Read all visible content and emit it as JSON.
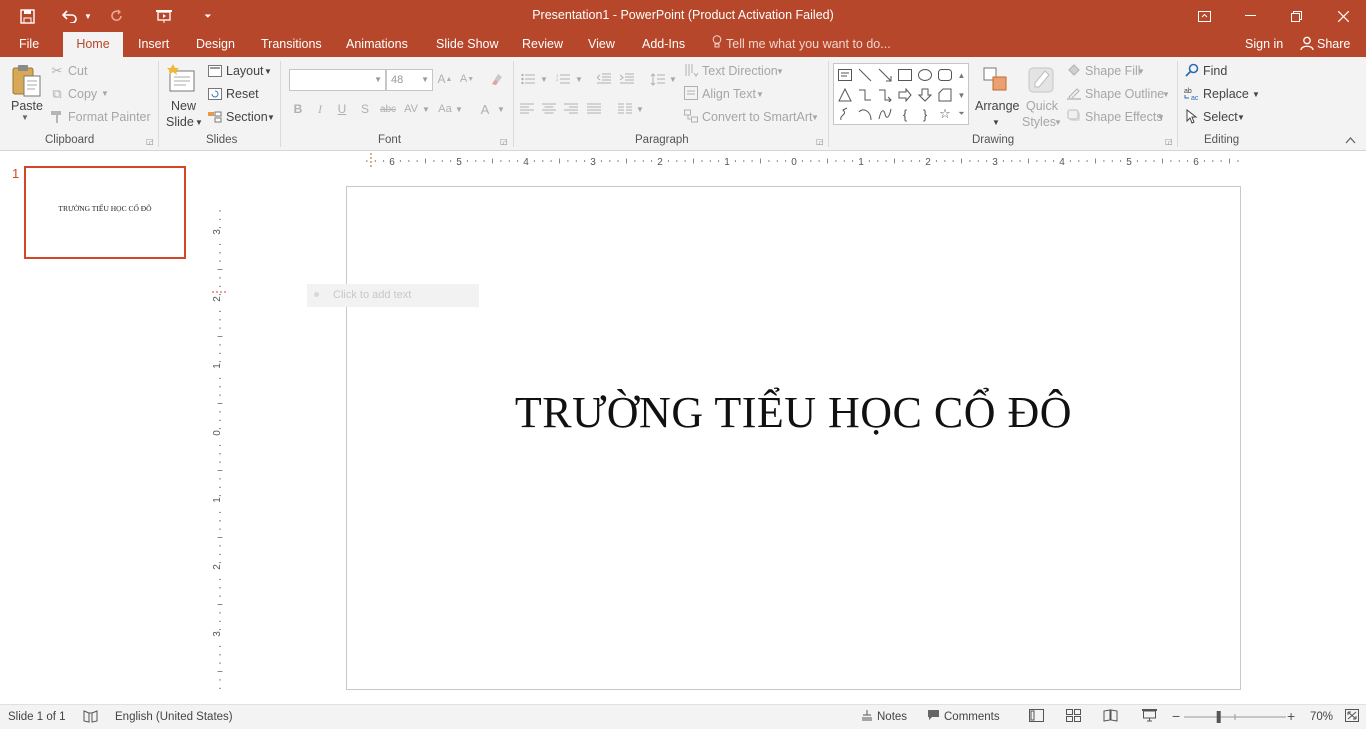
{
  "window": {
    "title": "Presentation1 - PowerPoint (Product Activation Failed)",
    "icons": [
      "save-icon",
      "undo-icon",
      "redo-icon",
      "start-from-beginning-icon",
      "customize-toolbar-icon",
      "ribbon-display-options-icon",
      "minimize-icon",
      "restore-icon",
      "close-icon"
    ]
  },
  "tabs": {
    "file": "File",
    "home": "Home",
    "insert": "Insert",
    "design": "Design",
    "transitions": "Transitions",
    "animations": "Animations",
    "slide_show": "Slide Show",
    "review": "Review",
    "view": "View",
    "add_ins": "Add-Ins",
    "tell_me": "Tell me what you want to do...",
    "sign_in": "Sign in",
    "share": "Share"
  },
  "ribbon": {
    "clipboard": {
      "paste": "Paste",
      "cut": "Cut",
      "copy": "Copy",
      "format_painter": "Format Painter",
      "label": "Clipboard"
    },
    "slides": {
      "new_slide_1": "New",
      "new_slide_2": "Slide",
      "layout": "Layout",
      "reset": "Reset",
      "section": "Section",
      "label": "Slides"
    },
    "font": {
      "font_name": "",
      "font_size": "48",
      "label": "Font",
      "bold": "B",
      "italic": "I",
      "underline": "U",
      "shadow": "S",
      "strike": "abc",
      "spacing": "AV",
      "case": "Aa",
      "color": "A"
    },
    "paragraph": {
      "label": "Paragraph",
      "text_direction": "Text Direction",
      "align_text": "Align Text",
      "convert_smartart": "Convert to SmartArt"
    },
    "drawing": {
      "label": "Drawing",
      "arrange": "Arrange",
      "quick_styles_1": "Quick",
      "quick_styles_2": "Styles",
      "shape_fill": "Shape Fill",
      "shape_outline": "Shape Outline",
      "shape_effects": "Shape Effects"
    },
    "editing": {
      "label": "Editing",
      "find": "Find",
      "replace": "Replace",
      "select": "Select"
    }
  },
  "slides_pane": {
    "thumbnails": [
      {
        "number": "1",
        "title": "TRƯỜNG TIỂU HỌC CỔ ĐÔ"
      }
    ]
  },
  "ruler": {
    "horizontal": [
      "6",
      "5",
      "4",
      "3",
      "2",
      "1",
      "0",
      "1",
      "2",
      "3",
      "4",
      "5",
      "6"
    ],
    "vertical": [
      "3",
      "2",
      "1",
      "0",
      "1",
      "2",
      "3"
    ]
  },
  "slide": {
    "title": "TRƯỜNG TIỂU HỌC CỔ ĐÔ",
    "ghost_hint": "Click to add text"
  },
  "status": {
    "slide_info": "Slide 1 of 1",
    "language": "English (United States)",
    "notes": "Notes",
    "comments": "Comments",
    "zoom": "70%",
    "zoom_level_percent": 70
  }
}
